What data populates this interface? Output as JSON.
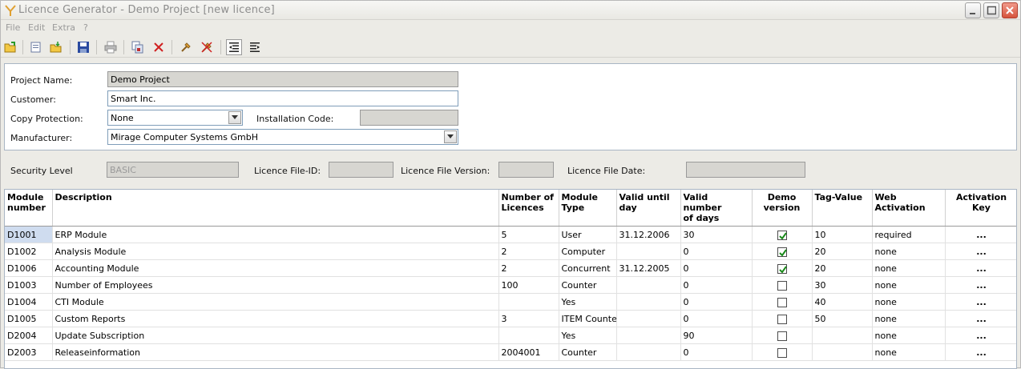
{
  "window": {
    "title": "Licence Generator - Demo Project [new licence]"
  },
  "menu": [
    "File",
    "Edit",
    "Extra",
    "?"
  ],
  "toolbar": {
    "icons": [
      "open-folder-icon",
      "new-document-icon",
      "open-icon",
      "save-icon",
      "print-icon",
      "copy-icon",
      "delete-icon",
      "tool-icon",
      "tool-delete-icon",
      "indent-left-icon",
      "indent-right-icon"
    ]
  },
  "form": {
    "project_name_label": "Project Name:",
    "project_name_value": "Demo Project",
    "customer_label": "Customer:",
    "customer_value": "Smart Inc.",
    "copy_protection_label": "Copy Protection:",
    "copy_protection_value": "None",
    "installation_code_label": "Installation Code:",
    "installation_code_value": "",
    "manufacturer_label": "Manufacturer:",
    "manufacturer_value": "Mirage Computer Systems GmbH"
  },
  "security": {
    "level_label": "Security Level",
    "level_value": "BASIC",
    "file_id_label": "Licence File-ID:",
    "file_id_value": "",
    "file_version_label": "Licence File Version:",
    "file_version_value": "",
    "file_date_label": "Licence File Date:",
    "file_date_value": ""
  },
  "table": {
    "headers": [
      [
        "Module",
        "number"
      ],
      [
        "Description",
        ""
      ],
      [
        "Number of",
        "Licences"
      ],
      [
        "Module",
        "Type"
      ],
      [
        "Valid until",
        "day"
      ],
      [
        "Valid number",
        "of days"
      ],
      [
        "Demo",
        "version"
      ],
      [
        "Tag-Value",
        ""
      ],
      [
        "Web",
        "Activation"
      ],
      [
        "Activation Key",
        ""
      ]
    ],
    "rows": [
      {
        "number": "D1001",
        "description": "ERP Module",
        "licences": "5",
        "type": "User",
        "valid_until": "31.12.2006",
        "valid_days": "30",
        "demo": true,
        "tag": "10",
        "web": "required",
        "key": "..."
      },
      {
        "number": "D1002",
        "description": "Analysis Module",
        "licences": "2",
        "type": "Computer",
        "valid_until": "",
        "valid_days": "0",
        "demo": true,
        "tag": "20",
        "web": "none",
        "key": "..."
      },
      {
        "number": "D1006",
        "description": "Accounting Module",
        "licences": "2",
        "type": "Concurrent",
        "valid_until": "31.12.2005",
        "valid_days": "0",
        "demo": true,
        "tag": "20",
        "web": "none",
        "key": "..."
      },
      {
        "number": "D1003",
        "description": "Number of Employees",
        "licences": "100",
        "type": "Counter",
        "valid_until": "",
        "valid_days": "0",
        "demo": false,
        "tag": "30",
        "web": "none",
        "key": "..."
      },
      {
        "number": "D1004",
        "description": "CTI Module",
        "licences": "",
        "type": "Yes",
        "valid_until": "",
        "valid_days": "0",
        "demo": false,
        "tag": "40",
        "web": "none",
        "key": "..."
      },
      {
        "number": "D1005",
        "description": "Custom Reports",
        "licences": "3",
        "type": "ITEM Counter",
        "valid_until": "",
        "valid_days": "0",
        "demo": false,
        "tag": "50",
        "web": "none",
        "key": "..."
      },
      {
        "number": "D2004",
        "description": "Update Subscription",
        "licences": "",
        "type": "Yes",
        "valid_until": "",
        "valid_days": "90",
        "demo": false,
        "tag": "",
        "web": "none",
        "key": "..."
      },
      {
        "number": "D2003",
        "description": "Releaseinformation",
        "licences": "2004001",
        "type": "Counter",
        "valid_until": "",
        "valid_days": "0",
        "demo": false,
        "tag": "",
        "web": "none",
        "key": "..."
      }
    ]
  },
  "colors": {
    "selection": "#cfdcef",
    "check": "#1a8a1a",
    "field_border": "#7f9db9",
    "readonly_bg": "#d7d6d1"
  }
}
